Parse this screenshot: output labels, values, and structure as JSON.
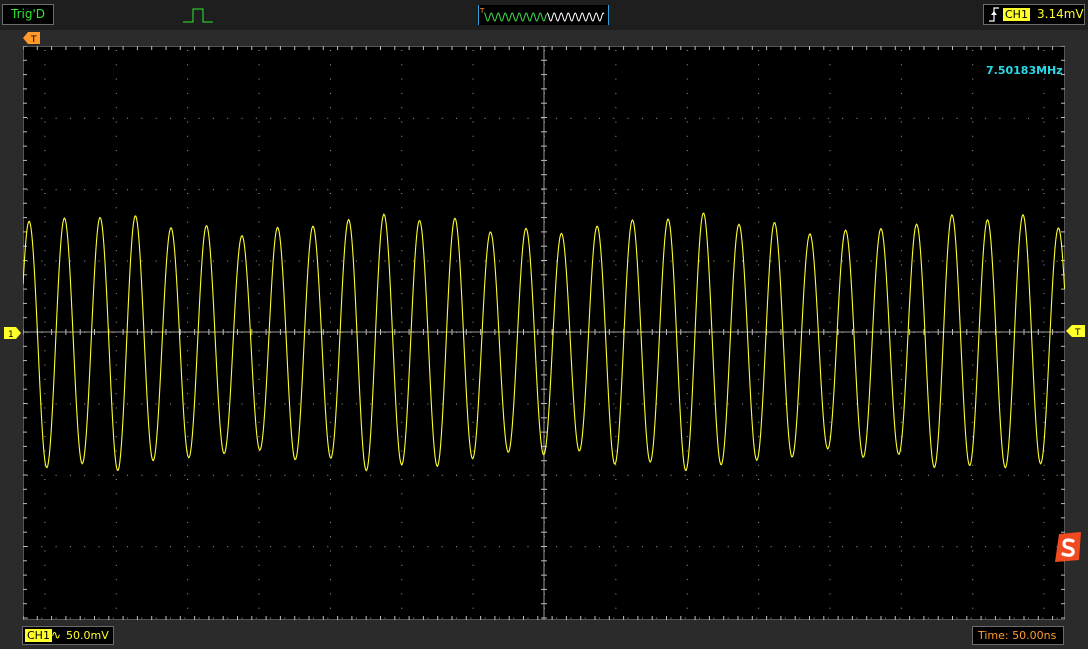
{
  "status": {
    "trigger_state": "Trig'D"
  },
  "trigger": {
    "channel": "CH1",
    "level": "3.14mV",
    "slope_icon": "rising-edge-icon",
    "position_marker": "T"
  },
  "channels": {
    "ch1": {
      "label": "CH1",
      "ground_marker": "1",
      "coupling_icon": "∿",
      "volts_per_div": "50.0mV"
    }
  },
  "timebase": {
    "label": "Time: 50.00ns"
  },
  "measurement": {
    "frequency": "7.50183MHz"
  },
  "colors": {
    "ch1": "#ffff2a",
    "trigger_state": "#2ee82e",
    "timebase": "#ff9a2a",
    "frequency": "#2ad8e8",
    "grid": "#a0a0a0"
  }
}
